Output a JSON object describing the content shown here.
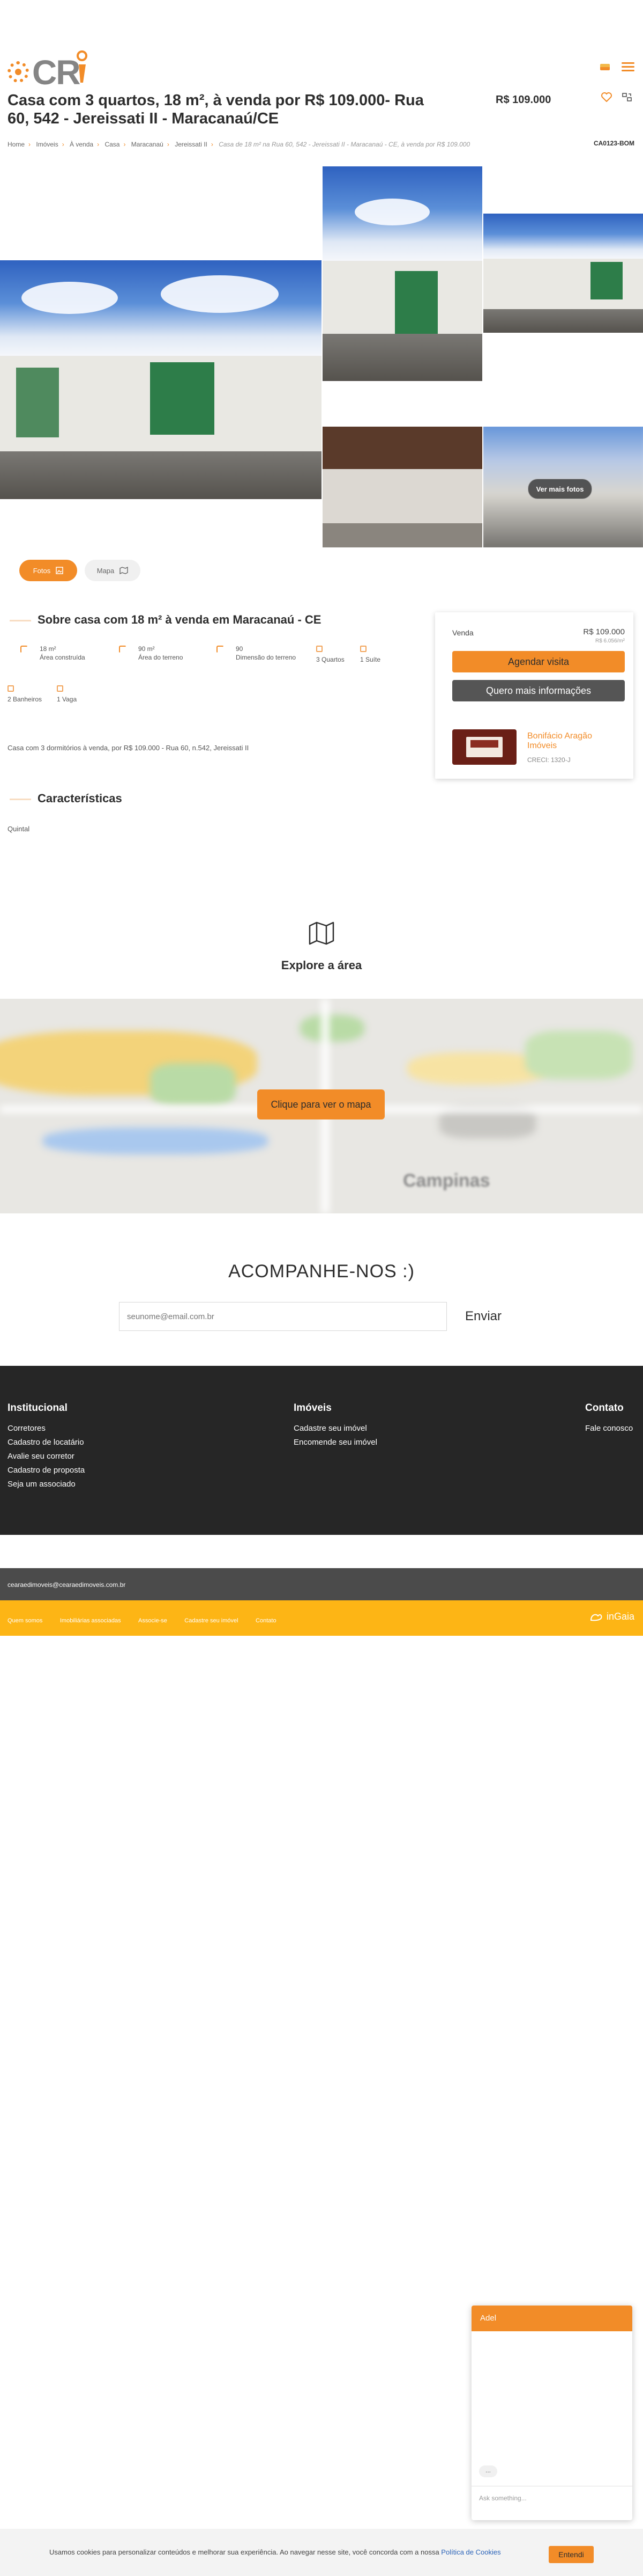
{
  "header": {
    "logo_text": "CR",
    "title": "Casa com 3 quartos, 18 m², à venda por R$ 109.000- Rua 60, 542 - Jereissati II - Maracanaú/CE",
    "price": "R$ 109.000"
  },
  "breadcrumb": [
    "Home",
    "Imóveis",
    "À venda",
    "Casa",
    "Maracanaú",
    "Jereissati II",
    "Casa de 18 m² na Rua 60, 542 - Jereissati II - Maracanaú - CE, à venda por R$ 109.000"
  ],
  "property_code": "CA0123-BOM",
  "gallery": {
    "see_more_label": "Ver mais fotos",
    "fotos_label": "Fotos",
    "mapa_label": "Mapa"
  },
  "about": {
    "title": "Sobre casa com 18 m² à venda em Maracanaú - CE",
    "features": [
      {
        "value": "18 m²",
        "label": "Área construída"
      },
      {
        "value": "90 m²",
        "label": "Área do terreno"
      },
      {
        "value": "90",
        "label": "Dimensão do terreno"
      },
      {
        "value": "3 Quartos",
        "label": ""
      },
      {
        "value": "1 Suíte",
        "label": ""
      }
    ],
    "features_row2": [
      "2 Banheiros",
      "1 Vaga"
    ],
    "description": "Casa com 3 dormitórios à venda, por R$ 109.000 - Rua 60, n.542, Jereissati II"
  },
  "characteristics": {
    "title": "Características",
    "items": [
      "Quintal"
    ]
  },
  "sidebar": {
    "type_label": "Venda",
    "price": "R$ 109.000",
    "price_per_m2": "R$ 6.056/m²",
    "schedule_label": "Agendar visita",
    "info_label": "Quero mais informações",
    "agent_name": "Bonifácio Aragão Imóveis",
    "agent_creci": "CRECI: 1320-J"
  },
  "map": {
    "title": "Explore a área",
    "button_label": "Clique para ver o mapa",
    "city_label": "Campinas"
  },
  "newsletter": {
    "title": "ACOMPANHE-NOS :)",
    "placeholder": "seunome@email.com.br",
    "send_label": "Enviar"
  },
  "footer": {
    "institucional": {
      "title": "Institucional",
      "items": [
        "Corretores",
        "Cadastro de locatário",
        "Avalie seu corretor",
        "Cadastro de proposta",
        "Seja um associado"
      ]
    },
    "imoveis": {
      "title": "Imóveis",
      "items": [
        "Cadastre seu imóvel",
        "Encomende seu imóvel"
      ]
    },
    "contato": {
      "title": "Contato",
      "items": [
        "Fale conosco"
      ]
    },
    "email": "cearaedimoveis@cearaedimoveis.com.br",
    "bottom_links": [
      "Quem somos",
      "Imobiliárias associadas",
      "Associe-se",
      "Cadastre seu imóvel",
      "Contato"
    ],
    "brand": "inGaia"
  },
  "chat": {
    "title": "Adel",
    "input_placeholder": "Ask something...",
    "bubble_text": "..."
  },
  "cookie": {
    "text": "Usamos cookies para personalizar conteúdos e melhorar sua experiência. Ao navegar nesse site, você concorda com a nossa ",
    "link": "Política de Cookies",
    "button": "Entendi"
  },
  "colors": {
    "accent": "#f28c28",
    "footer_dark": "#262626",
    "footer_orange": "#fdb515"
  }
}
